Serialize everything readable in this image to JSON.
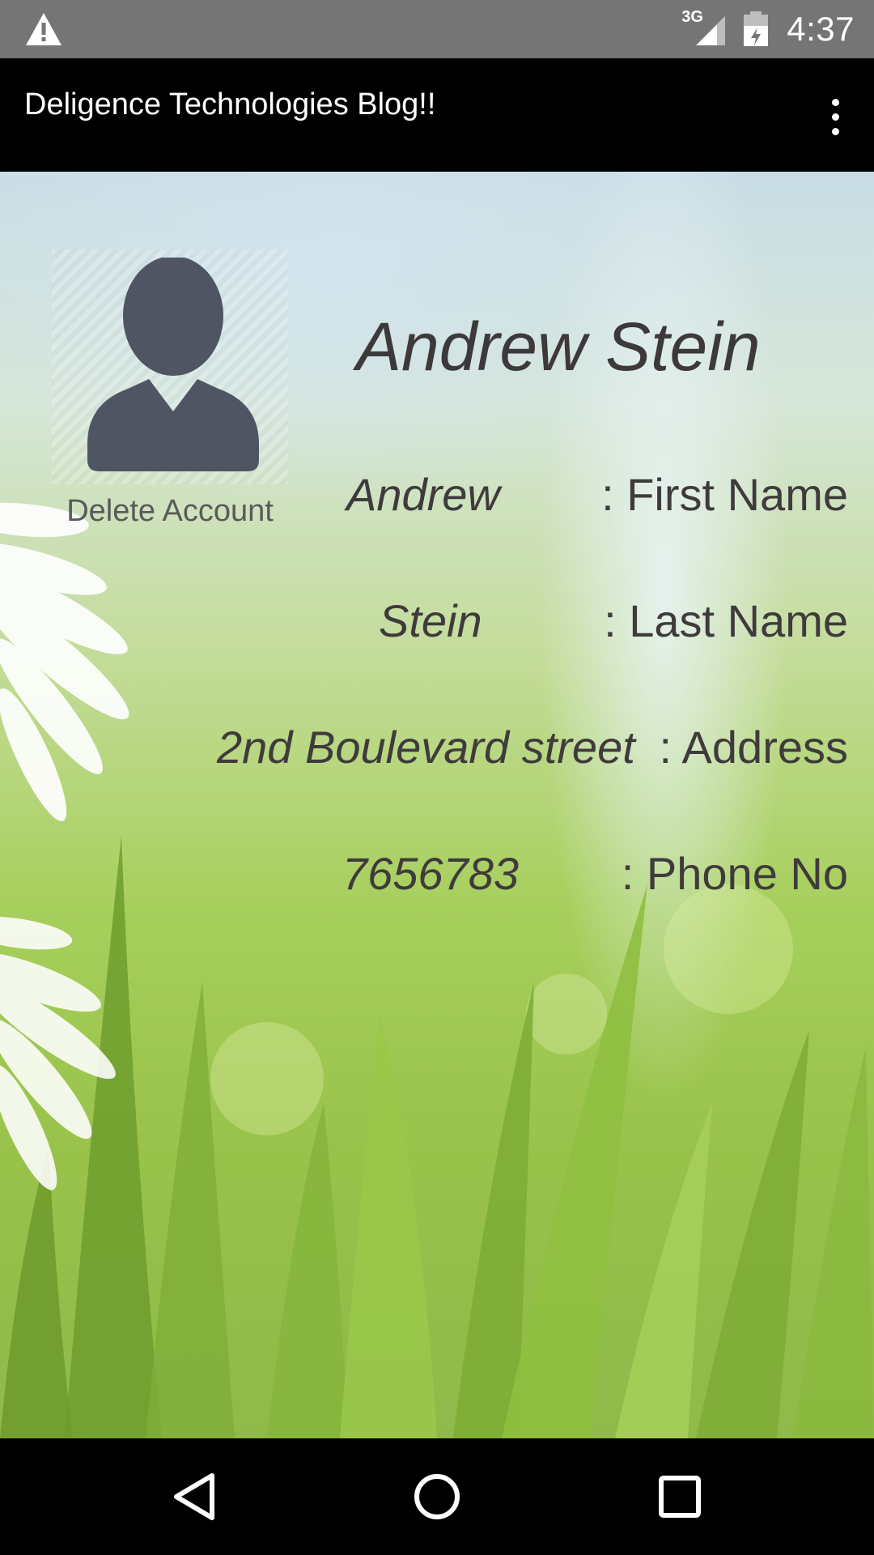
{
  "status_bar": {
    "warning_icon": "warning-icon",
    "network": "3G",
    "time": "4:37"
  },
  "app_bar": {
    "title": "Deligence Technologies Blog!!",
    "menu_icon": "overflow-menu-icon"
  },
  "profile": {
    "avatar_icon": "person-avatar-icon",
    "delete_label": "Delete Account",
    "full_name": "Andrew Stein",
    "details": [
      {
        "value": "Andrew",
        "label": ": First Name"
      },
      {
        "value": "Stein",
        "label": ": Last Name"
      },
      {
        "value": "2nd Boulevard street",
        "label": ": Address"
      },
      {
        "value": "7656783",
        "label": ": Phone No"
      }
    ]
  },
  "nav_bar": {
    "back_icon": "back-icon",
    "home_icon": "home-icon",
    "recents_icon": "recents-icon"
  }
}
